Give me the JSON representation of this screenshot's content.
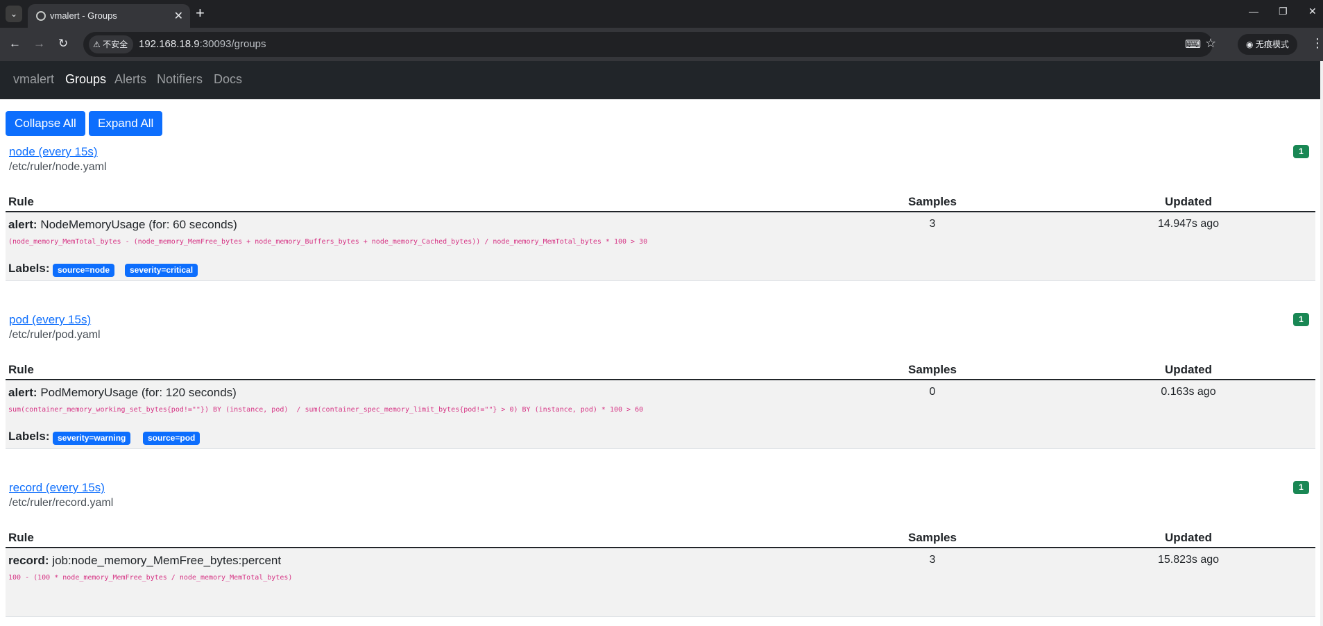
{
  "browser": {
    "tab_title": "vmalert - Groups",
    "security_label": "不安全",
    "url_host": "192.168.18.9",
    "url_path": ":30093/groups",
    "incognito_label": "无痕模式",
    "icons": [
      "tab-search-icon",
      "globe-icon",
      "close-icon",
      "plus-icon",
      "minimize-icon",
      "restore-icon",
      "back-icon",
      "forward-icon",
      "reload-icon",
      "warning-icon",
      "translate-icon",
      "star-icon",
      "incognito-icon",
      "kebab-menu-icon"
    ]
  },
  "nav": {
    "brand": "vmalert",
    "items": [
      {
        "label": "Groups",
        "active": true
      },
      {
        "label": "Alerts",
        "active": false
      },
      {
        "label": "Notifiers",
        "active": false
      },
      {
        "label": "Docs",
        "active": false
      }
    ]
  },
  "actions": {
    "collapse_all": "Collapse All",
    "expand_all": "Expand All"
  },
  "table_headers": {
    "rule": "Rule",
    "samples": "Samples",
    "updated": "Updated"
  },
  "labels_heading": "Labels:",
  "groups": [
    {
      "name": "node (every 15s)",
      "file": "/etc/ruler/node.yaml",
      "count": "1",
      "rule": {
        "kind": "alert:",
        "name": "NodeMemoryUsage (for: 60 seconds)",
        "expr": "(node_memory_MemTotal_bytes - (node_memory_MemFree_bytes + node_memory_Buffers_bytes + node_memory_Cached_bytes)) / node_memory_MemTotal_bytes * 100 > 30",
        "samples": "3",
        "updated": "14.947s ago",
        "labels": [
          "source=node",
          "severity=critical"
        ]
      }
    },
    {
      "name": "pod (every 15s)",
      "file": "/etc/ruler/pod.yaml",
      "count": "1",
      "rule": {
        "kind": "alert:",
        "name": "PodMemoryUsage (for: 120 seconds)",
        "expr": "sum(container_memory_working_set_bytes{pod!=\"\"}) BY (instance, pod)  / sum(container_spec_memory_limit_bytes{pod!=\"\"} > 0) BY (instance, pod) * 100 > 60",
        "samples": "0",
        "updated": "0.163s ago",
        "labels": [
          "severity=warning",
          "source=pod"
        ]
      }
    },
    {
      "name": "record (every 15s)",
      "file": "/etc/ruler/record.yaml",
      "count": "1",
      "rule": {
        "kind": "record:",
        "name": "job:node_memory_MemFree_bytes:percent",
        "expr": "100 - (100 * node_memory_MemFree_bytes / node_memory_MemTotal_bytes)",
        "samples": "3",
        "updated": "15.823s ago",
        "labels": []
      }
    }
  ]
}
